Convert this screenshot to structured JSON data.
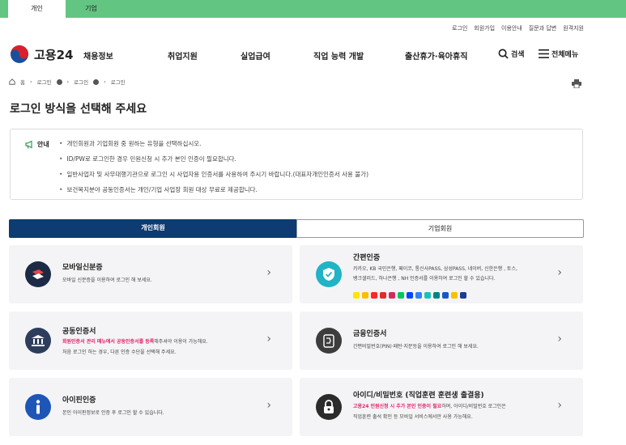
{
  "top_tabs": {
    "personal": "개인",
    "corporate": "기업"
  },
  "util_links": [
    "로그인",
    "회원가입",
    "이용안내",
    "질문과 답변",
    "원격지원"
  ],
  "logo": {
    "text": "고용24"
  },
  "gnb": [
    "채용정보",
    "취업지원",
    "실업급여",
    "직업 능력 개발",
    "출산휴가·육아휴직"
  ],
  "search_label": "검색",
  "menu_label": "전체메뉴",
  "breadcrumb": {
    "home": "홈",
    "level1": "로그인",
    "level2": "로그인",
    "level3": "로그인"
  },
  "page_title": "로그인 방식을 선택해 주세요",
  "notice": {
    "label": "안내",
    "items": [
      "개인회원과 기업회원 중 원하는 유형을 선택하십시오.",
      "ID/PW로 로그인한 경우 민원신청 시 추가 본인 인증이 필요합니다.",
      "일반사업자 및 사무대행기관으로 로그인 시 사업자용 인증서를 사용하여 주시기 바랍니다.(대표자개인인증서 사용 불가)",
      "보건복지분야 공동인증서는 개인/기업 사업장 회원 대상 무료로 제공합니다."
    ]
  },
  "member_tabs": {
    "personal": "개인회원",
    "corporate": "기업회원"
  },
  "cards": {
    "mobile": {
      "title": "모바일신분증",
      "desc": "모바일 신분증을 이용하여 로그인 해 보세요."
    },
    "simple": {
      "title": "간편인증",
      "desc1": "카카오, KB 국민은행, 페이코, 통신사PASS, 삼성PASS, 네이버, 신한은행 , 토스,",
      "desc2": "뱅크샐러드, 하나은행 , NH 인증서를 이용하여 로그인 할 수 있습니다."
    },
    "joint": {
      "title": "공동인증서",
      "desc1_red": "회원인증서 관리 메뉴에서 공동인증서를 등록",
      "desc1_rest": "해주셔야 이용이 가능해요.",
      "desc2": "처음 로그인 하는 경우, 다른 인증 수단을 선택해 주세요."
    },
    "finance": {
      "title": "금융인증서",
      "desc": "간편비밀번호(PIN)·패턴·지문등을 이용하여 로그인 해 보세요."
    },
    "ipin": {
      "title": "아이핀인증",
      "desc": "본인 아이핀정보로 인증 후 로그인 할 수 있습니다."
    },
    "idpw": {
      "title": "아이디/비밀번호 (직업훈련 훈련생 출결용)",
      "desc1_red": "고용24 민원신청 시 추가 본인 인증이 필요",
      "desc1_rest": "하며, 아이디/비밀번호 로그인은",
      "desc2": "직업훈련 출석 확인 등 모바일 서비스에서만 사용 가능해요."
    }
  },
  "chevron": "›",
  "colors": {
    "green": "#63c582",
    "navy": "#0d3b72",
    "accent": "#e5236b"
  }
}
